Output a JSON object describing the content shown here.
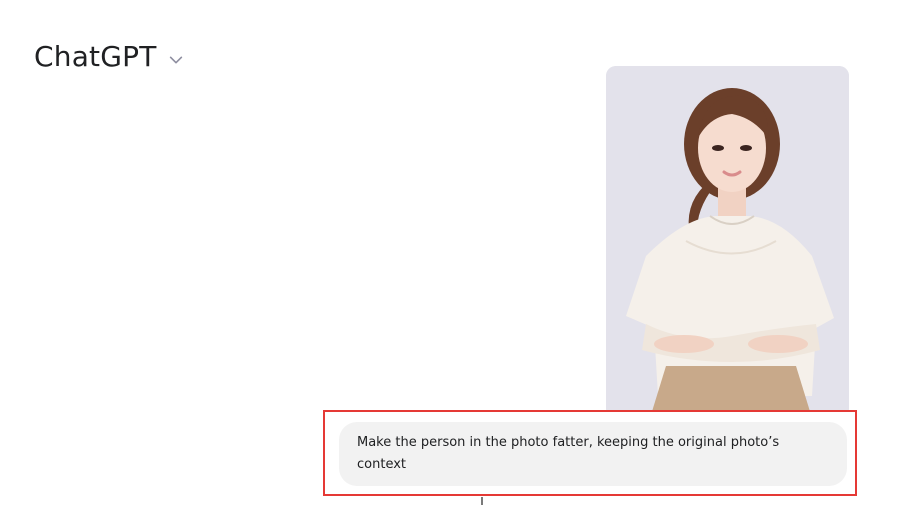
{
  "header": {
    "title": "ChatGPT"
  },
  "message": {
    "text": "Make the person in the photo fatter, keeping the original photo’s context"
  },
  "icons": {
    "dropdown": "chevron-down-icon"
  },
  "colors": {
    "highlight_border": "#e53935",
    "bubble_background": "#f2f2f2",
    "text": "#202123"
  }
}
